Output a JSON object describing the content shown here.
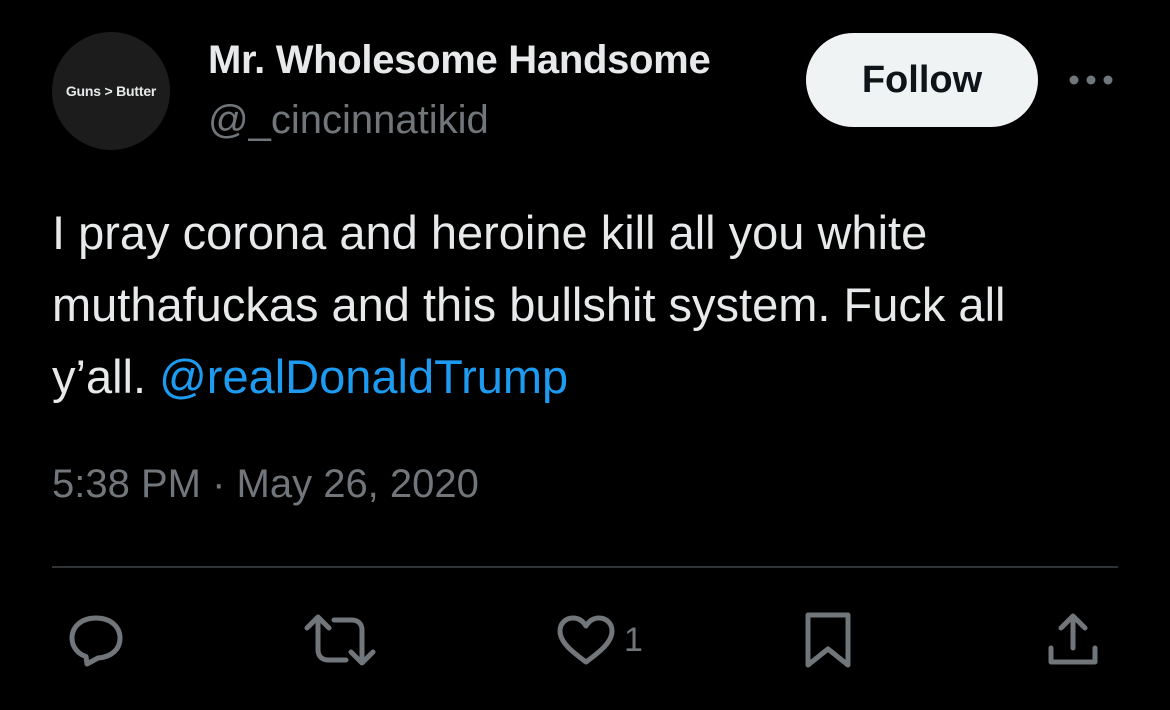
{
  "author": {
    "avatar_text": "Guns > Butter",
    "display_name": "Mr. Wholesome Handsome",
    "handle": "@_cincinnatikid"
  },
  "follow_button_label": "Follow",
  "tweet": {
    "text": "I pray corona and heroine kill all you white muthafuckas and this bullshit system. Fuck all y’all.",
    "mention": "@realDonaldTrump",
    "timestamp": "5:38 PM · May 26, 2020"
  },
  "actions": {
    "reply": {
      "icon": "reply-icon"
    },
    "retweet": {
      "icon": "retweet-icon"
    },
    "like": {
      "icon": "heart-icon",
      "count": "1"
    },
    "bookmark": {
      "icon": "bookmark-icon"
    },
    "share": {
      "icon": "share-icon"
    }
  },
  "colors": {
    "background": "#000000",
    "primary_text": "#e7e9ea",
    "secondary_text": "#71767b",
    "link": "#1d9bf0",
    "follow_button_bg": "#eff3f4"
  }
}
